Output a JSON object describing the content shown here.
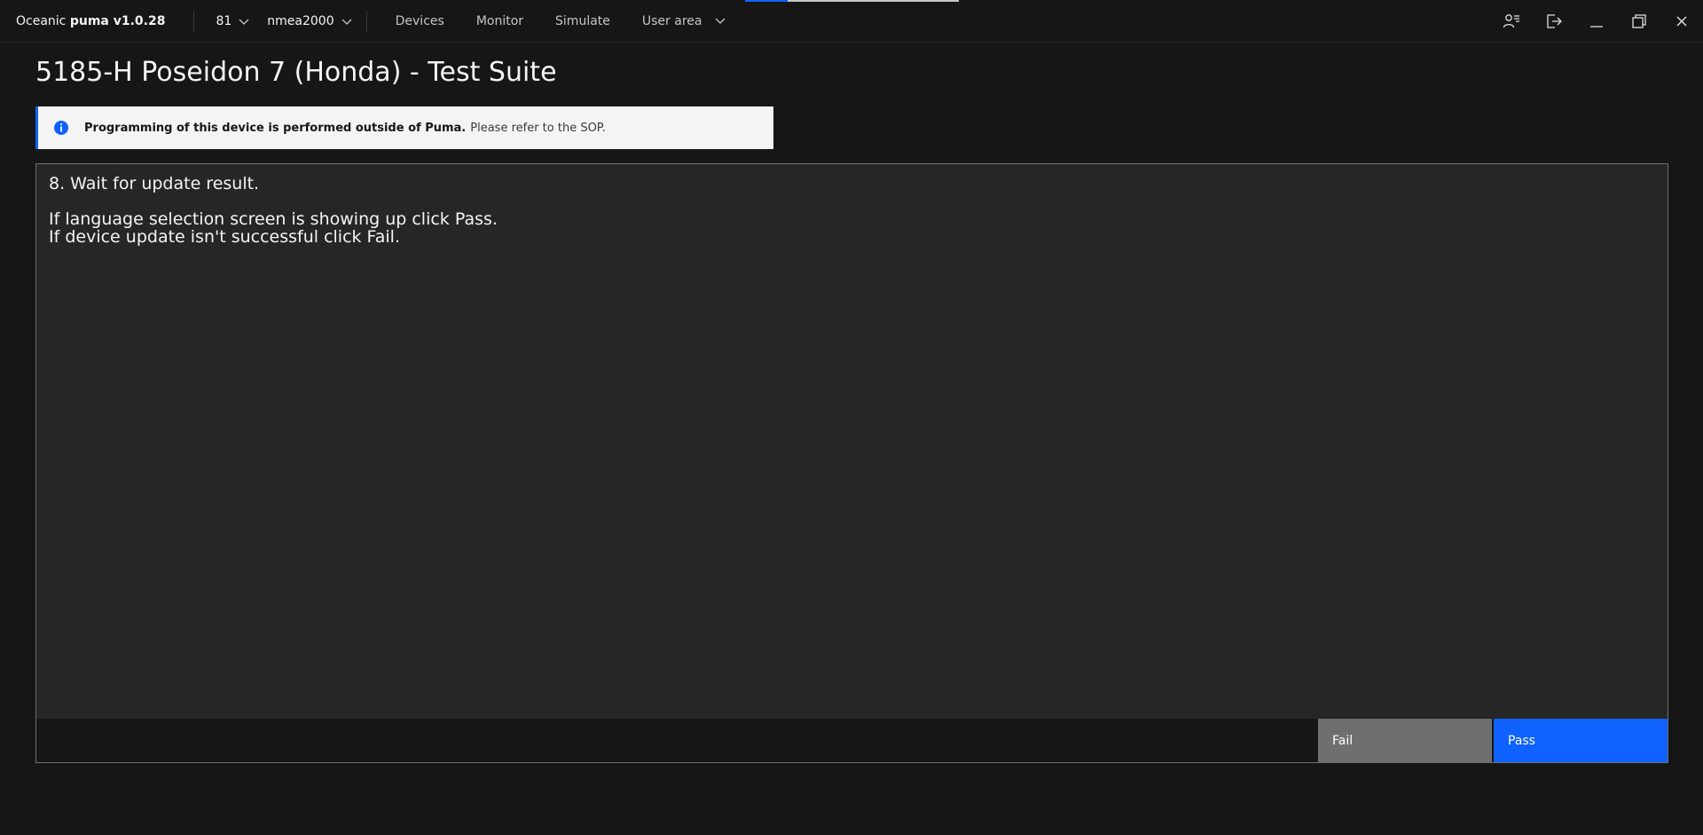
{
  "app": {
    "brand_prefix": "Oceanic ",
    "brand_name": "puma v1.0.28"
  },
  "header": {
    "port_value": "81",
    "protocol_value": "nmea2000",
    "nav": {
      "devices": "Devices",
      "monitor": "Monitor",
      "simulate": "Simulate",
      "user_area": "User area"
    },
    "icons": [
      "user-list-icon",
      "logout-icon",
      "minimize-icon",
      "maximize-icon",
      "close-icon"
    ]
  },
  "page": {
    "title": "5185-H Poseidon 7 (Honda) - Test Suite"
  },
  "notification": {
    "kind": "info",
    "title": "Programming of this device is performed outside of Puma.",
    "subtitle": "Please refer to the SOP."
  },
  "step": {
    "title": "8. Wait for update result.",
    "lines": [
      "If language selection screen is showing up click Pass.",
      "If device update isn't successful click Fail."
    ]
  },
  "actions": {
    "fail_label": "Fail",
    "pass_label": "Pass"
  },
  "colors": {
    "background": "#161616",
    "panel": "#262626",
    "accent": "#0f62fe",
    "fail_button": "#6f6f6f",
    "notification_bg": "#f4f4f4"
  }
}
